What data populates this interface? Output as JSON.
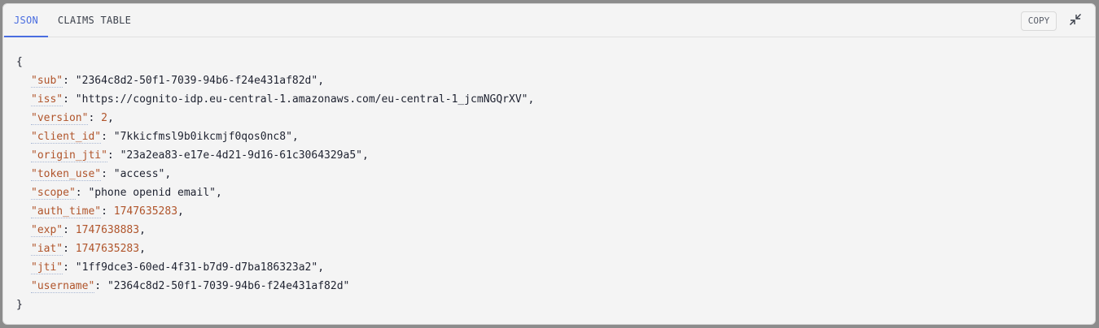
{
  "tabs": {
    "json": "JSON",
    "claims": "CLAIMS TABLE"
  },
  "toolbar": {
    "copy_label": "COPY"
  },
  "json_view": {
    "open_brace": "{",
    "close_brace": "}",
    "entries": [
      {
        "key": "\"sub\"",
        "value": "\"2364c8d2-50f1-7039-94b6-f24e431af82d\"",
        "type": "string",
        "comma": ","
      },
      {
        "key": "\"iss\"",
        "value": "\"https://cognito-idp.eu-central-1.amazonaws.com/eu-central-1_jcmNGQrXV\"",
        "type": "string",
        "comma": ","
      },
      {
        "key": "\"version\"",
        "value": "2",
        "type": "number",
        "comma": ","
      },
      {
        "key": "\"client_id\"",
        "value": "\"7kkicfmsl9b0ikcmjf0qos0nc8\"",
        "type": "string",
        "comma": ","
      },
      {
        "key": "\"origin_jti\"",
        "value": "\"23a2ea83-e17e-4d21-9d16-61c3064329a5\"",
        "type": "string",
        "comma": ","
      },
      {
        "key": "\"token_use\"",
        "value": "\"access\"",
        "type": "string",
        "comma": ","
      },
      {
        "key": "\"scope\"",
        "value": "\"phone openid email\"",
        "type": "string",
        "comma": ","
      },
      {
        "key": "\"auth_time\"",
        "value": "1747635283",
        "type": "number",
        "comma": ","
      },
      {
        "key": "\"exp\"",
        "value": "1747638883",
        "type": "number",
        "comma": ","
      },
      {
        "key": "\"iat\"",
        "value": "1747635283",
        "type": "number",
        "comma": ","
      },
      {
        "key": "\"jti\"",
        "value": "\"1ff9dce3-60ed-4f31-b7d9-d7ba186323a2\"",
        "type": "string",
        "comma": ","
      },
      {
        "key": "\"username\"",
        "value": "\"2364c8d2-50f1-7039-94b6-f24e431af82d\"",
        "type": "string",
        "comma": ""
      }
    ]
  },
  "colors": {
    "accent": "#4a6de0",
    "key": "#b0542a",
    "text": "#1e2230"
  },
  "icons": {
    "collapse": "collapse-arrows-icon"
  }
}
